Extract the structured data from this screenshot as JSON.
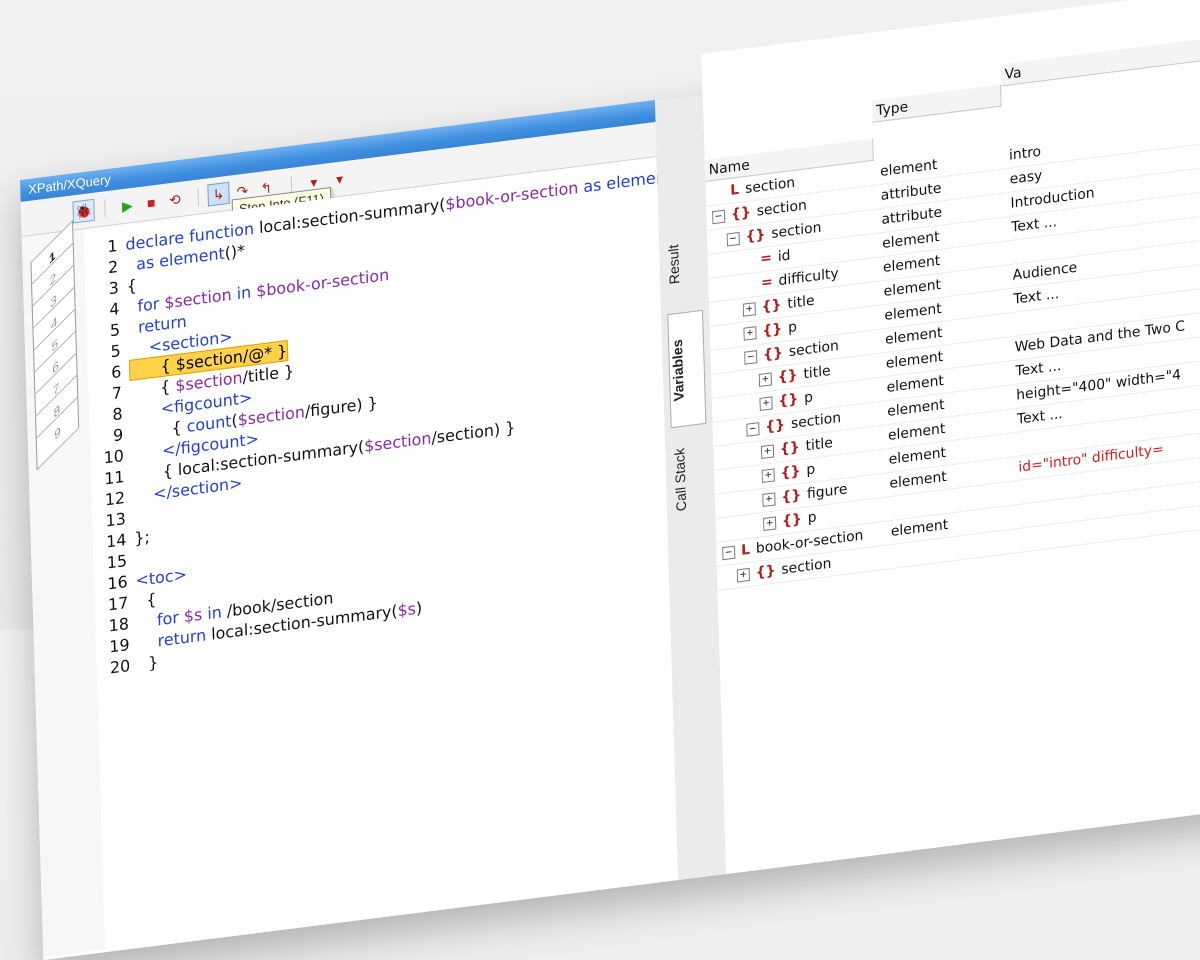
{
  "window": {
    "title": "XPath/XQuery"
  },
  "toolbar": {
    "tooltip": "Step Into (F11)",
    "buttons": [
      {
        "name": "debug-icon",
        "glyph": "🐞"
      },
      {
        "name": "run-icon",
        "glyph": "▶"
      },
      {
        "name": "stop-icon",
        "glyph": "■"
      },
      {
        "name": "restart-icon",
        "glyph": "⟲"
      },
      {
        "name": "step-into-icon",
        "glyph": "↳"
      },
      {
        "name": "step-over-icon",
        "glyph": "↷"
      },
      {
        "name": "step-out-icon",
        "glyph": "↰"
      },
      {
        "name": "breakpoint-icon",
        "glyph": "▾"
      },
      {
        "name": "tracepoint-icon",
        "glyph": "▾"
      }
    ]
  },
  "editor": {
    "tab_numbers": [
      "1",
      "2",
      "3",
      "4",
      "5",
      "6",
      "7",
      "8",
      "9"
    ],
    "lines": [
      {
        "n": "1",
        "parts": [
          [
            "kw",
            "declare function "
          ],
          [
            "txt",
            "local:section-summary("
          ],
          [
            "var",
            "$book-or-section"
          ],
          [
            "kw",
            " as element"
          ],
          [
            "txt",
            "(*)"
          ]
        ]
      },
      {
        "n": "2",
        "parts": [
          [
            "kw",
            "  as element"
          ],
          [
            "txt",
            "()*"
          ]
        ]
      },
      {
        "n": "3",
        "parts": [
          [
            "txt",
            "{"
          ]
        ]
      },
      {
        "n": "4",
        "parts": [
          [
            "kw",
            "  for "
          ],
          [
            "var",
            "$section"
          ],
          [
            "kw",
            " in "
          ],
          [
            "var",
            "$book-or-section"
          ]
        ]
      },
      {
        "n": "5",
        "parts": [
          [
            "kw",
            "  return"
          ]
        ]
      },
      {
        "n": "5",
        "parts": [
          [
            "kw",
            "    <section>"
          ]
        ]
      },
      {
        "n": "6",
        "parts": [
          [
            "hl",
            "      { $section/@* }"
          ]
        ]
      },
      {
        "n": "7",
        "parts": [
          [
            "txt",
            "      { "
          ],
          [
            "var",
            "$section"
          ],
          [
            "txt",
            "/title }"
          ]
        ]
      },
      {
        "n": "8",
        "parts": [
          [
            "kw",
            "      <figcount>"
          ]
        ]
      },
      {
        "n": "9",
        "parts": [
          [
            "txt",
            "        { "
          ],
          [
            "fn",
            "count"
          ],
          [
            "txt",
            "("
          ],
          [
            "var",
            "$section"
          ],
          [
            "txt",
            "/figure) }"
          ]
        ]
      },
      {
        "n": "10",
        "parts": [
          [
            "kw",
            "      </figcount>"
          ]
        ]
      },
      {
        "n": "11",
        "parts": [
          [
            "txt",
            "      { local:section-summary("
          ],
          [
            "var",
            "$section"
          ],
          [
            "txt",
            "/section) }"
          ]
        ]
      },
      {
        "n": "12",
        "parts": [
          [
            "kw",
            "    </section>"
          ]
        ]
      },
      {
        "n": "13",
        "parts": [
          [
            "txt",
            ""
          ]
        ]
      },
      {
        "n": "14",
        "parts": [
          [
            "txt",
            "};"
          ]
        ]
      },
      {
        "n": "15",
        "parts": [
          [
            "txt",
            ""
          ]
        ]
      },
      {
        "n": "16",
        "parts": [
          [
            "kw",
            "<toc>"
          ]
        ]
      },
      {
        "n": "17",
        "parts": [
          [
            "txt",
            "  {"
          ]
        ]
      },
      {
        "n": "18",
        "parts": [
          [
            "kw",
            "    for "
          ],
          [
            "var",
            "$s"
          ],
          [
            "kw",
            " in "
          ],
          [
            "txt",
            "/book/section"
          ]
        ]
      },
      {
        "n": "19",
        "parts": [
          [
            "kw",
            "    return "
          ],
          [
            "txt",
            "local:section-summary("
          ],
          [
            "var",
            "$s"
          ],
          [
            "txt",
            ")"
          ]
        ]
      },
      {
        "n": "20",
        "parts": [
          [
            "txt",
            "  }"
          ]
        ]
      }
    ]
  },
  "side_tabs": [
    "Result",
    "Variables",
    "Call Stack"
  ],
  "vars": {
    "columns": [
      "Name",
      "Type",
      "Va"
    ],
    "rows": [
      {
        "indent": 0,
        "exp": "",
        "icon": "L",
        "name": "section",
        "type": "element",
        "value": "intro",
        "red": false
      },
      {
        "indent": 0,
        "exp": "−",
        "icon": "{}",
        "name": "section",
        "type": "attribute",
        "value": "easy",
        "red": false
      },
      {
        "indent": 1,
        "exp": "−",
        "icon": "{}",
        "name": "section",
        "type": "attribute",
        "value": "Introduction",
        "red": false
      },
      {
        "indent": 2,
        "exp": "",
        "icon": "=",
        "name": "id",
        "type": "element",
        "value": "Text ...",
        "red": false
      },
      {
        "indent": 2,
        "exp": "",
        "icon": "=",
        "name": "difficulty",
        "type": "element",
        "value": "",
        "red": false
      },
      {
        "indent": 2,
        "exp": "+",
        "icon": "{}",
        "name": "title",
        "type": "element",
        "value": "Audience",
        "red": false
      },
      {
        "indent": 2,
        "exp": "+",
        "icon": "{}",
        "name": "p",
        "type": "element",
        "value": "Text ...",
        "red": false
      },
      {
        "indent": 2,
        "exp": "−",
        "icon": "{}",
        "name": "section",
        "type": "element",
        "value": "",
        "red": false
      },
      {
        "indent": 3,
        "exp": "+",
        "icon": "{}",
        "name": "title",
        "type": "element",
        "value": "Web Data and the Two C",
        "red": false
      },
      {
        "indent": 3,
        "exp": "+",
        "icon": "{}",
        "name": "p",
        "type": "element",
        "value": "Text ...",
        "red": false
      },
      {
        "indent": 2,
        "exp": "−",
        "icon": "{}",
        "name": "section",
        "type": "element",
        "value": "height=\"400\" width=\"4",
        "red": false
      },
      {
        "indent": 3,
        "exp": "+",
        "icon": "{}",
        "name": "title",
        "type": "element",
        "value": "Text ...",
        "red": false
      },
      {
        "indent": 3,
        "exp": "+",
        "icon": "{}",
        "name": "p",
        "type": "element",
        "value": "",
        "red": false
      },
      {
        "indent": 3,
        "exp": "+",
        "icon": "{}",
        "name": "figure",
        "type": "element",
        "value": "id=\"intro\" difficulty=",
        "red": true
      },
      {
        "indent": 3,
        "exp": "+",
        "icon": "{}",
        "name": "p",
        "type": "",
        "value": "",
        "red": false
      },
      {
        "indent": 0,
        "exp": "−",
        "icon": "L",
        "name": "book-or-section",
        "type": "element",
        "value": "",
        "red": false
      },
      {
        "indent": 1,
        "exp": "+",
        "icon": "{}",
        "name": "section",
        "type": "",
        "value": "",
        "red": false
      }
    ]
  },
  "colors": {
    "titlebar": "#3f8fe0",
    "keyword": "#1f3fd6",
    "variable": "#8a2aa8",
    "highlight": "#ffd24a",
    "icon_red": "#b21e1e"
  }
}
